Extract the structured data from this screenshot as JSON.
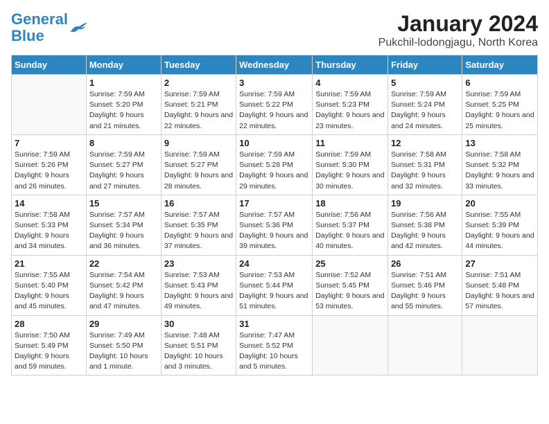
{
  "header": {
    "logo_line1": "General",
    "logo_line2": "Blue",
    "month_title": "January 2024",
    "location": "Pukchil-lodongjagu, North Korea"
  },
  "weekdays": [
    "Sunday",
    "Monday",
    "Tuesday",
    "Wednesday",
    "Thursday",
    "Friday",
    "Saturday"
  ],
  "weeks": [
    [
      {
        "day": "",
        "sunrise": "",
        "sunset": "",
        "daylight": ""
      },
      {
        "day": "1",
        "sunrise": "7:59 AM",
        "sunset": "5:20 PM",
        "daylight": "9 hours and 21 minutes."
      },
      {
        "day": "2",
        "sunrise": "7:59 AM",
        "sunset": "5:21 PM",
        "daylight": "9 hours and 22 minutes."
      },
      {
        "day": "3",
        "sunrise": "7:59 AM",
        "sunset": "5:22 PM",
        "daylight": "9 hours and 22 minutes."
      },
      {
        "day": "4",
        "sunrise": "7:59 AM",
        "sunset": "5:23 PM",
        "daylight": "9 hours and 23 minutes."
      },
      {
        "day": "5",
        "sunrise": "7:59 AM",
        "sunset": "5:24 PM",
        "daylight": "9 hours and 24 minutes."
      },
      {
        "day": "6",
        "sunrise": "7:59 AM",
        "sunset": "5:25 PM",
        "daylight": "9 hours and 25 minutes."
      }
    ],
    [
      {
        "day": "7",
        "sunrise": "7:59 AM",
        "sunset": "5:26 PM",
        "daylight": "9 hours and 26 minutes."
      },
      {
        "day": "8",
        "sunrise": "7:59 AM",
        "sunset": "5:27 PM",
        "daylight": "9 hours and 27 minutes."
      },
      {
        "day": "9",
        "sunrise": "7:59 AM",
        "sunset": "5:27 PM",
        "daylight": "9 hours and 28 minutes."
      },
      {
        "day": "10",
        "sunrise": "7:59 AM",
        "sunset": "5:28 PM",
        "daylight": "9 hours and 29 minutes."
      },
      {
        "day": "11",
        "sunrise": "7:59 AM",
        "sunset": "5:30 PM",
        "daylight": "9 hours and 30 minutes."
      },
      {
        "day": "12",
        "sunrise": "7:58 AM",
        "sunset": "5:31 PM",
        "daylight": "9 hours and 32 minutes."
      },
      {
        "day": "13",
        "sunrise": "7:58 AM",
        "sunset": "5:32 PM",
        "daylight": "9 hours and 33 minutes."
      }
    ],
    [
      {
        "day": "14",
        "sunrise": "7:58 AM",
        "sunset": "5:33 PM",
        "daylight": "9 hours and 34 minutes."
      },
      {
        "day": "15",
        "sunrise": "7:57 AM",
        "sunset": "5:34 PM",
        "daylight": "9 hours and 36 minutes."
      },
      {
        "day": "16",
        "sunrise": "7:57 AM",
        "sunset": "5:35 PM",
        "daylight": "9 hours and 37 minutes."
      },
      {
        "day": "17",
        "sunrise": "7:57 AM",
        "sunset": "5:36 PM",
        "daylight": "9 hours and 39 minutes."
      },
      {
        "day": "18",
        "sunrise": "7:56 AM",
        "sunset": "5:37 PM",
        "daylight": "9 hours and 40 minutes."
      },
      {
        "day": "19",
        "sunrise": "7:56 AM",
        "sunset": "5:38 PM",
        "daylight": "9 hours and 42 minutes."
      },
      {
        "day": "20",
        "sunrise": "7:55 AM",
        "sunset": "5:39 PM",
        "daylight": "9 hours and 44 minutes."
      }
    ],
    [
      {
        "day": "21",
        "sunrise": "7:55 AM",
        "sunset": "5:40 PM",
        "daylight": "9 hours and 45 minutes."
      },
      {
        "day": "22",
        "sunrise": "7:54 AM",
        "sunset": "5:42 PM",
        "daylight": "9 hours and 47 minutes."
      },
      {
        "day": "23",
        "sunrise": "7:53 AM",
        "sunset": "5:43 PM",
        "daylight": "9 hours and 49 minutes."
      },
      {
        "day": "24",
        "sunrise": "7:53 AM",
        "sunset": "5:44 PM",
        "daylight": "9 hours and 51 minutes."
      },
      {
        "day": "25",
        "sunrise": "7:52 AM",
        "sunset": "5:45 PM",
        "daylight": "9 hours and 53 minutes."
      },
      {
        "day": "26",
        "sunrise": "7:51 AM",
        "sunset": "5:46 PM",
        "daylight": "9 hours and 55 minutes."
      },
      {
        "day": "27",
        "sunrise": "7:51 AM",
        "sunset": "5:48 PM",
        "daylight": "9 hours and 57 minutes."
      }
    ],
    [
      {
        "day": "28",
        "sunrise": "7:50 AM",
        "sunset": "5:49 PM",
        "daylight": "9 hours and 59 minutes."
      },
      {
        "day": "29",
        "sunrise": "7:49 AM",
        "sunset": "5:50 PM",
        "daylight": "10 hours and 1 minute."
      },
      {
        "day": "30",
        "sunrise": "7:48 AM",
        "sunset": "5:51 PM",
        "daylight": "10 hours and 3 minutes."
      },
      {
        "day": "31",
        "sunrise": "7:47 AM",
        "sunset": "5:52 PM",
        "daylight": "10 hours and 5 minutes."
      },
      {
        "day": "",
        "sunrise": "",
        "sunset": "",
        "daylight": ""
      },
      {
        "day": "",
        "sunrise": "",
        "sunset": "",
        "daylight": ""
      },
      {
        "day": "",
        "sunrise": "",
        "sunset": "",
        "daylight": ""
      }
    ]
  ]
}
